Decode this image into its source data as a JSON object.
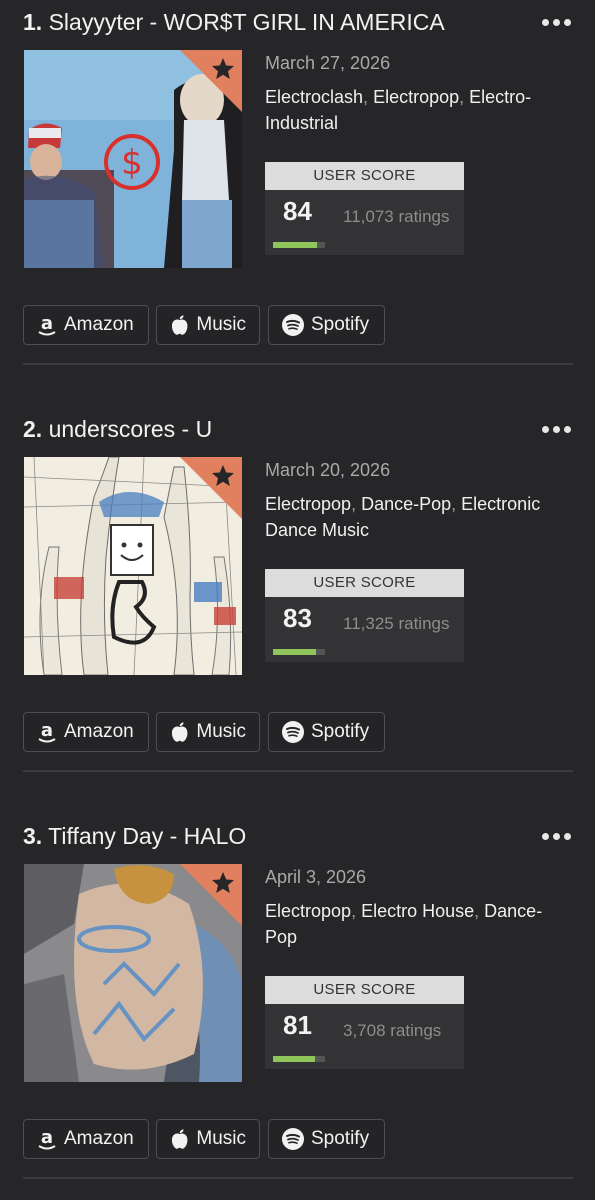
{
  "albums": [
    {
      "rank": "1.",
      "title": "Slayyyter - WOR$T GIRL IN AMERICA",
      "date": "March 27, 2026",
      "genres": [
        "Electroclash",
        "Electropop",
        "Electro-Industrial"
      ],
      "score_label": "USER SCORE",
      "score": "84",
      "score_fraction": 0.84,
      "ratings": "11,073 ratings",
      "cover_text": "WOR$T GIRL IN AMERICA"
    },
    {
      "rank": "2.",
      "title": "underscores - U",
      "date": "March 20, 2026",
      "genres": [
        "Electropop",
        "Dance-Pop",
        "Electronic Dance Music"
      ],
      "score_label": "USER SCORE",
      "score": "83",
      "score_fraction": 0.83,
      "ratings": "11,325 ratings"
    },
    {
      "rank": "3.",
      "title": "Tiffany Day - HALO",
      "date": "April 3, 2026",
      "genres": [
        "Electropop",
        "Electro House",
        "Dance-Pop"
      ],
      "score_label": "USER SCORE",
      "score": "81",
      "score_fraction": 0.81,
      "ratings": "3,708 ratings"
    }
  ],
  "stores": {
    "amazon": "Amazon",
    "music": "Music",
    "spotify": "Spotify"
  },
  "icons": {
    "more": "more-icon",
    "star": "star-icon",
    "amazon": "amazon-icon",
    "apple": "apple-icon",
    "spotify": "spotify-icon"
  },
  "colors": {
    "background": "#262628",
    "score_header": "#dcdcdc",
    "score_fill": "#8fc55a",
    "star_corner": "#e0805e"
  }
}
